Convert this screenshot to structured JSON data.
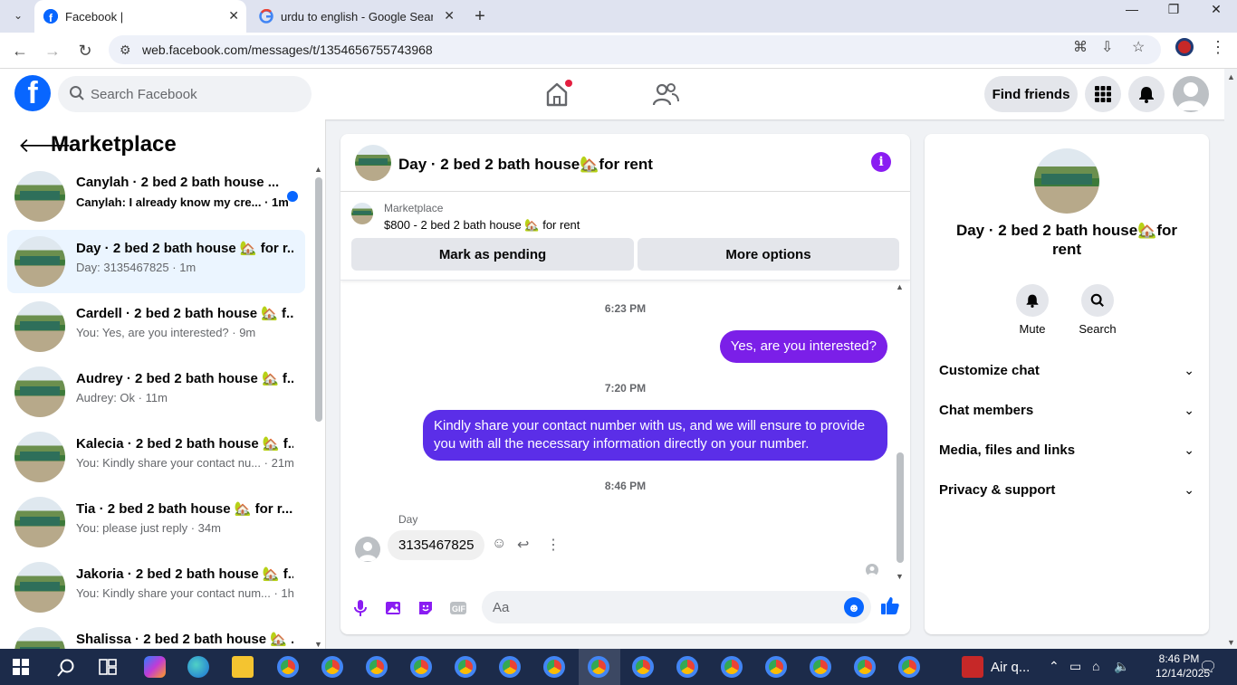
{
  "browser": {
    "tabs": [
      {
        "title": "Facebook |",
        "active": true
      },
      {
        "title": "urdu to english - Google Search",
        "active": false
      }
    ],
    "url": "web.facebook.com/messages/t/1354656755743968"
  },
  "header": {
    "search_placeholder": "Search Facebook",
    "find_friends": "Find friends"
  },
  "sidebar": {
    "title": "Marketplace",
    "conversations": [
      {
        "title": "Canylah · 2 bed 2 bath house ...",
        "subtitle": "Canylah: I already know my cre... · 1m",
        "unread": true
      },
      {
        "title": "Day · 2 bed 2 bath house 🏡 for r...",
        "subtitle": "Day: 3135467825 · 1m",
        "selected": true
      },
      {
        "title": "Cardell · 2 bed 2 bath house 🏡 f...",
        "subtitle": "You: Yes, are you interested? · 9m"
      },
      {
        "title": "Audrey · 2 bed 2 bath house 🏡 f...",
        "subtitle": "Audrey: Ok · 11m"
      },
      {
        "title": "Kalecia · 2 bed 2 bath house 🏡 f...",
        "subtitle": "You: Kindly share your contact nu... · 21m"
      },
      {
        "title": "Tia · 2 bed 2 bath house 🏡 for r...",
        "subtitle": "You: please just reply · 34m"
      },
      {
        "title": "Jakoria · 2 bed 2 bath house 🏡 f...",
        "subtitle": "You: Kindly share your contact num... · 1h"
      },
      {
        "title": "Shalissa · 2 bed 2 bath house 🏡 ...",
        "subtitle": ""
      }
    ]
  },
  "chat": {
    "title": "Day · 2 bed 2 bath house🏡for rent",
    "listing_label": "Marketplace",
    "listing_text": "$800 - 2 bed 2 bath house 🏡 for rent",
    "mark_pending": "Mark as pending",
    "more_options": "More options",
    "messages": {
      "ts1": "6:23 PM",
      "out1": "Yes, are you interested?",
      "ts2": "7:20 PM",
      "out2": "Kindly share your contact number with us, and we will ensure to provide you with all the necessary information directly on your number.",
      "ts3": "8:46 PM",
      "sender": "Day",
      "in1": "3135467825"
    },
    "composer_placeholder": "Aa",
    "composer_gif": "GIF"
  },
  "details": {
    "title": "Day · 2 bed 2 bath house🏡for rent",
    "mute": "Mute",
    "search": "Search",
    "sections": [
      "Customize chat",
      "Chat members",
      "Media, files and links",
      "Privacy & support"
    ]
  },
  "taskbar": {
    "air_quality": "Air q...",
    "time": "8:46 PM",
    "date": "12/14/2025"
  },
  "colors": {
    "fb_blue": "#0866ff",
    "messenger_purple": "#8a1cf2",
    "selected_row": "#ebf5ff"
  }
}
